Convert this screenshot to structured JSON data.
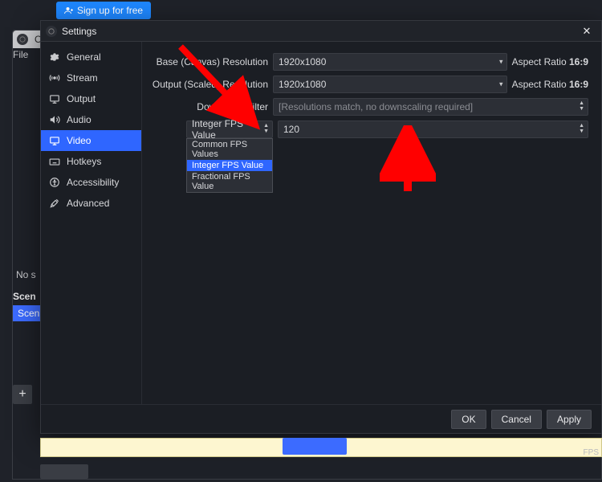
{
  "signup": {
    "label": "Sign up for free"
  },
  "bg": {
    "title": "O",
    "menu_file": "File",
    "no_s": "No s",
    "panel_head": "Scen",
    "panel_row": "Scen",
    "plus": "+",
    "fps_suffix": "FPS"
  },
  "settings": {
    "title": "Settings",
    "sidebar": [
      {
        "label": "General"
      },
      {
        "label": "Stream"
      },
      {
        "label": "Output"
      },
      {
        "label": "Audio"
      },
      {
        "label": "Video"
      },
      {
        "label": "Hotkeys"
      },
      {
        "label": "Accessibility"
      },
      {
        "label": "Advanced"
      }
    ],
    "rows": {
      "base_label": "Base (Canvas) Resolution",
      "base_value": "1920x1080",
      "scaled_label": "Output (Scaled) Resolution",
      "scaled_value": "1920x1080",
      "downscale_label": "Downscale Filter",
      "downscale_value": "[Resolutions match, no downscaling required]",
      "aspect_label": "Aspect Ratio",
      "aspect_value": "16:9",
      "fps_combo_label": "Integer FPS Value",
      "fps_value": "120",
      "fps_options": [
        "Common FPS Values",
        "Integer FPS Value",
        "Fractional FPS Value"
      ]
    },
    "footer": {
      "ok": "OK",
      "cancel": "Cancel",
      "apply": "Apply"
    }
  }
}
